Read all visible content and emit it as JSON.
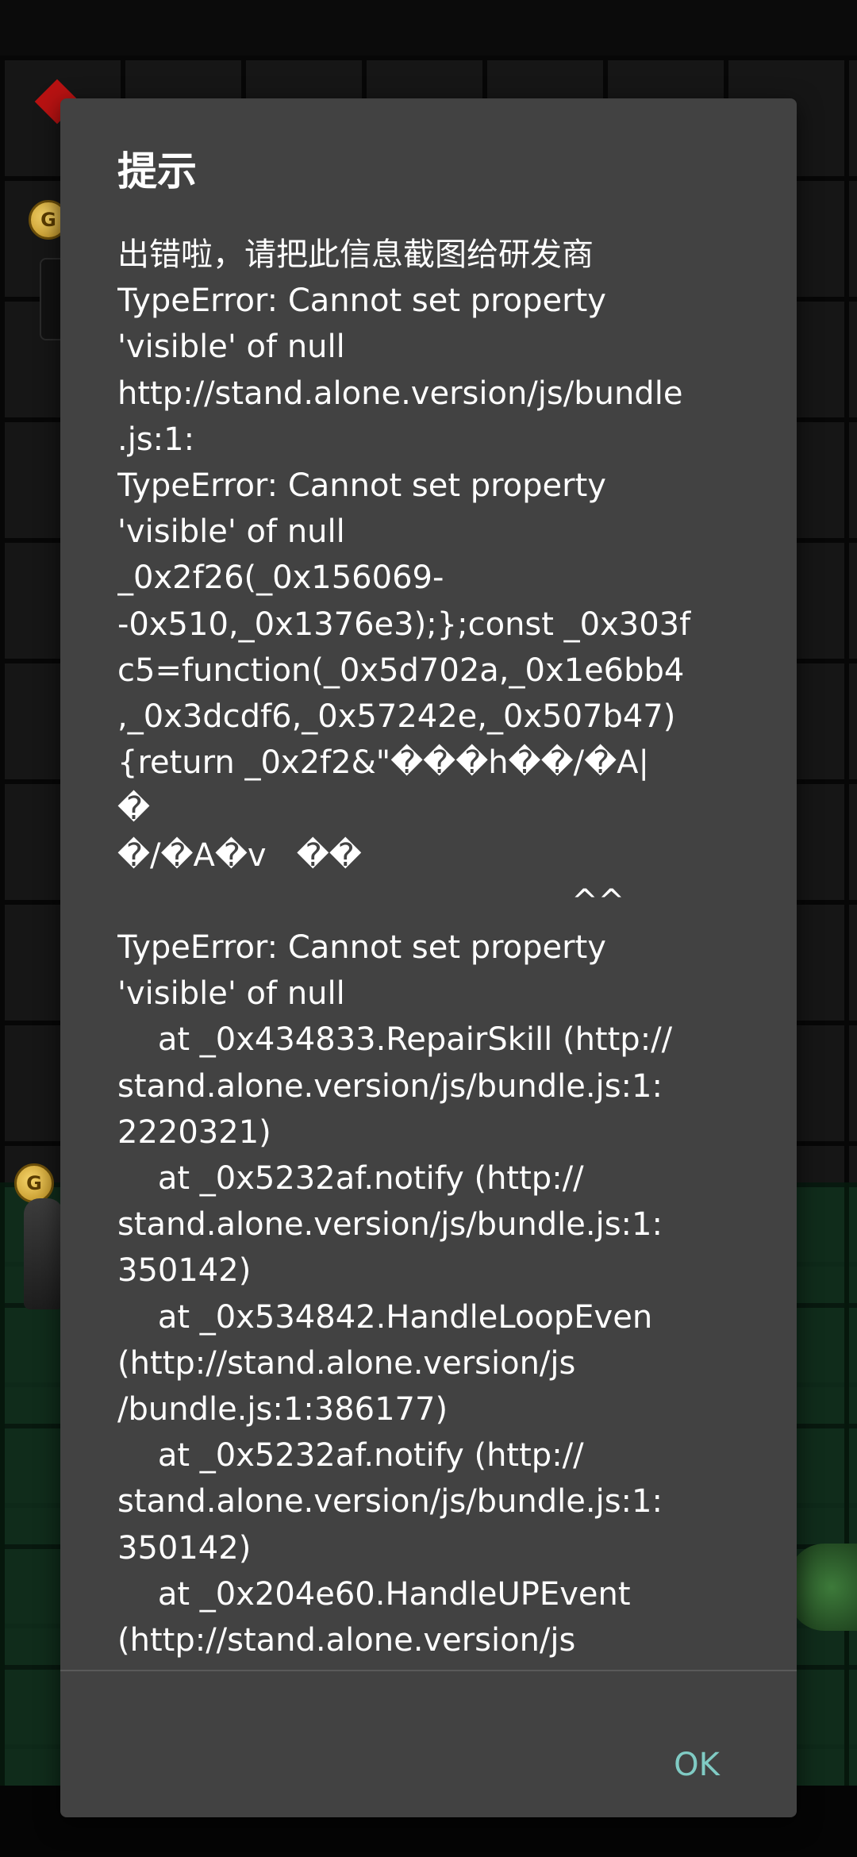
{
  "dialog": {
    "title": "提示",
    "message_lines": [
      "出错啦，请把此信息截图给研发商",
      "TypeError: Cannot set property",
      "'visible' of null",
      "http://stand.alone.version/js/bundle",
      ".js:1:",
      "TypeError: Cannot set property",
      "'visible' of null",
      "_0x2f26(_0x156069-",
      "-0x510,_0x1376e3);};const _0x303f",
      "c5=function(_0x5d702a,_0x1e6bb4",
      ",_0x3dcdf6,_0x57242e,_0x507b47)",
      "{return _0x2f2&\"���h��/�A|",
      "�",
      "�/�A�v   ��",
      "                                             ^^",
      "TypeError: Cannot set property",
      "'visible' of null",
      "    at _0x434833.RepairSkill (http://",
      "stand.alone.version/js/bundle.js:1:",
      "2220321)",
      "    at _0x5232af.notify (http://",
      "stand.alone.version/js/bundle.js:1:",
      "350142)",
      "    at _0x534842.HandleLoopEven",
      "(http://stand.alone.version/js",
      "/bundle.js:1:386177)",
      "    at _0x5232af.notify (http://",
      "stand.alone.version/js/bundle.js:1:",
      "350142)",
      "    at _0x204e60.HandleUPEvent",
      "(http://stand.alone.version/js"
    ],
    "ok_label": "OK"
  },
  "background": {
    "coin_letter": "G"
  },
  "colors": {
    "dialog_bg": "#424242",
    "text": "#ffffff",
    "accent": "#80cbc4"
  }
}
